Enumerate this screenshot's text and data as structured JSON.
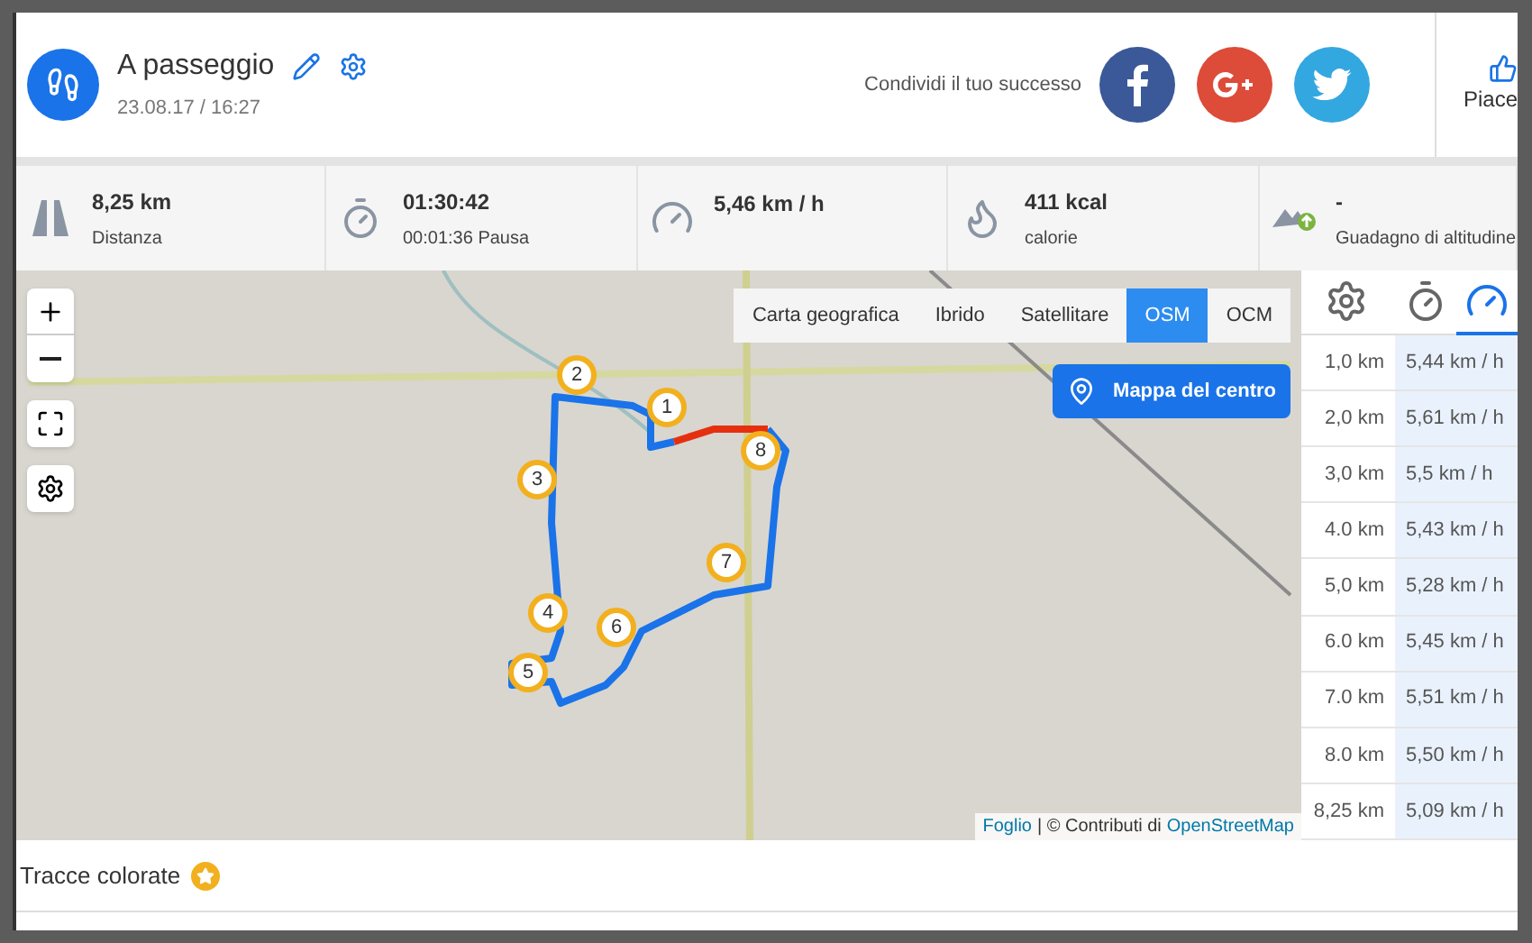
{
  "activity": {
    "title": "A passeggio",
    "datetime": "23.08.17 / 16:27"
  },
  "share": {
    "label": "Condividi il tuo successo",
    "buttons": [
      {
        "kind": "facebook"
      },
      {
        "kind": "google"
      },
      {
        "kind": "twitter"
      }
    ],
    "like_label": "Piace"
  },
  "stats": [
    {
      "kind": "road",
      "value": "8,25 km",
      "label": "Distanza"
    },
    {
      "kind": "timer",
      "value": "01:30:42",
      "label": "00:01:36 Pausa"
    },
    {
      "kind": "speed",
      "value": "5,46 km / h"
    },
    {
      "kind": "flame",
      "value": "411 kcal",
      "label": "calorie"
    },
    {
      "kind": "altitude",
      "value": "-",
      "label": "Guadagno di altitudine"
    }
  ],
  "map": {
    "layers": [
      {
        "label": "Carta geografica",
        "selected": false
      },
      {
        "label": "Ibrido",
        "selected": false
      },
      {
        "label": "Satellitare",
        "selected": false
      },
      {
        "label": "OSM",
        "selected": true
      },
      {
        "label": "OCM",
        "selected": false
      }
    ],
    "center_button": "Mappa del centro",
    "markers": [
      "1",
      "2",
      "3",
      "4",
      "5",
      "6",
      "7",
      "8"
    ],
    "attribution": {
      "link1": "Foglio",
      "text": "| © Contributi di",
      "link2": "OpenStreetMap"
    }
  },
  "splits": {
    "tabs": [
      {
        "kind": "settings",
        "selected": false
      },
      {
        "kind": "timer",
        "selected": false
      },
      {
        "kind": "speed",
        "selected": true
      }
    ],
    "rows": [
      {
        "distance": "1,0 km",
        "speed": "5,44 km / h"
      },
      {
        "distance": "2,0 km",
        "speed": "5,61 km / h"
      },
      {
        "distance": "3,0 km",
        "speed": "5,5 km / h"
      },
      {
        "distance": "4.0 km",
        "speed": "5,43 km / h"
      },
      {
        "distance": "5,0 km",
        "speed": "5,28 km / h"
      },
      {
        "distance": "6.0 km",
        "speed": "5,45 km / h"
      },
      {
        "distance": "7.0 km",
        "speed": "5,51 km / h"
      },
      {
        "distance": "8.0 km",
        "speed": "5,50 km / h"
      },
      {
        "distance": "8,25 km",
        "speed": "5,09 km / h"
      }
    ]
  },
  "footer": {
    "label": "Tracce colorate"
  }
}
